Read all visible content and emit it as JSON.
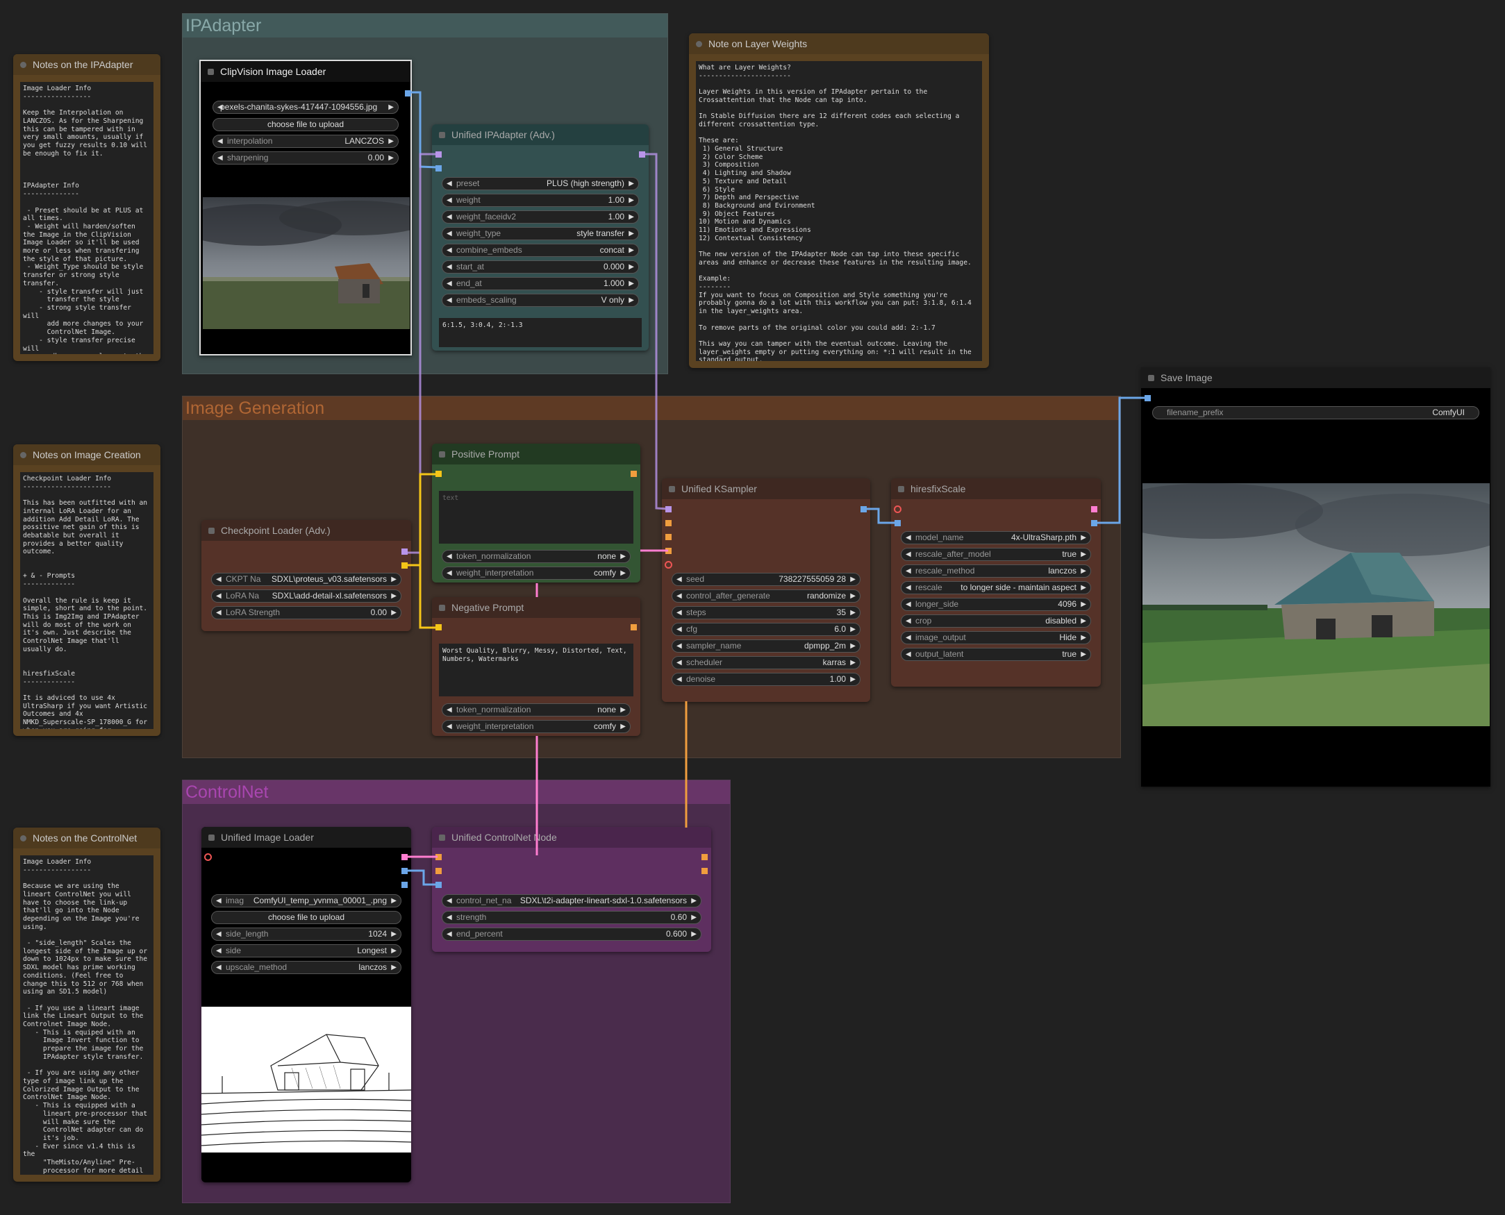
{
  "groups": {
    "ipadapter": {
      "title": "IPAdapter",
      "color": "#88a8a8"
    },
    "imagegen": {
      "title": "Image Generation",
      "color": "#b06634"
    },
    "controlnet": {
      "title": "ControlNet",
      "color": "#a946b0"
    }
  },
  "notes": {
    "ipadapter": {
      "title": "Notes on the IPAdapter",
      "text": "Image Loader Info\n-----------------\n\nKeep the Interpolation on LANCZOS. As for the Sharpening this can be tampered with in very small amounts, usually if you get fuzzy results 0.10 will be enough to fix it.\n\n\n\nIPAdapter Info\n--------------\n\n - Preset should be at PLUS at all times.\n - Weight will harden/soften the Image in the ClipVision Image Loader so it'll be used more or less when transfering the style of that picture.\n - Weight_Type should be style transfer or strong style transfer.\n    - style transfer will just\n      transfer the style\n    - strong style transfer will\n      add more changes to your\n      ControlNet Image.\n    - style transfer precise will\n      adhere even closer to the\n      original."
    },
    "layer_weights": {
      "title": "Note on Layer Weights",
      "text": "What are Layer Weights?\n-----------------------\n\nLayer Weights in this version of IPAdapter pertain to the Crossattention that the Node can tap into.\n\nIn Stable Diffusion there are 12 different codes each selecting a different crossattention type.\n\nThese are:\n 1) General Structure\n 2) Color Scheme\n 3) Composition\n 4) Lighting and Shadow\n 5) Texture and Detail\n 6) Style\n 7) Depth and Perspective\n 8) Background and Evironment\n 9) Object Features\n10) Motion and Dynamics\n11) Emotions and Expressions\n12) Contextual Consistency\n\nThe new version of the IPAdapter Node can tap into these specific areas and enhance or decrease these features in the resulting image.\n\nExample:\n--------\nIf you want to focus on Composition and Style something you're probably gonna do a lot with this workflow you can put: 3:1.8, 6:1.4 in the layer_weights area.\n\nTo remove parts of the original color you could add: 2:-1.7\n\nThis way you can tamper with the eventual outcome. Leaving the layer_weights empty or putting everything on: *:1 will result in the standard output."
    },
    "image_creation": {
      "title": "Notes on Image Creation",
      "text": "Checkpoint Loader Info\n----------------------\n\nThis has been outfitted with an internal LoRA Loader for an addition Add Detail LoRA. The possitive net gain of this is debatable but overall it provides a better quality outcome.\n\n\n+ & - Prompts\n-------------\n\nOverall the rule is keep it simple, short and to the point. This is Img2Img and IPAdapter will do most of the work on it's own. Just describe the ControlNet Image that'll usually do.\n\n\nhiresfixScale\n-------------\n\nIt is adviced to use 4x UltraSharp if you want Artistic Outcomes and 4x NMKD_Superscale-SP_178000_G for when you are going for Photographic style transfers."
    },
    "controlnet": {
      "title": "Notes on the ControlNet",
      "text": "Image Loader Info\n-----------------\n\nBecause we are using the lineart ControlNet you will have to choose the link-up that'll go into the Node depending on the Image you're using.\n\n - \"side_length\" Scales the longest side of the Image up or down to 1024px to make sure the SDXL model has prime working conditions. (Feel free to change this to 512 or 768 when using an SD1.5 model)\n\n - If you use a lineart image link the Lineart Output to the Controlnet Image Node.\n   - This is equiped with an\n     Image Invert function to\n     prepare the image for the\n     IPAdapter style transfer.\n\n - If you are using any other type of image link up the Colorized Image Output to the ControlNet Image Node.\n   - This is equipped with a\n     lineart pre-processor that\n     will make sure the\n     ControlNet adapter can do\n     it's job.\n   - Ever since v1.4 this is the\n     \"TheMisto/Anyline\" Pre-\n     processor for more detail to\n     the resulting LineArt Image."
    }
  },
  "clipvision": {
    "title": "ClipVision Image Loader",
    "image": "pexels-chanita-sykes-417447-1094556.jpg",
    "upload": "choose file to upload",
    "widgets": [
      {
        "label": "interpolation",
        "value": "LANCZOS"
      },
      {
        "label": "sharpening",
        "value": "0.00"
      }
    ]
  },
  "ipadapter_node": {
    "title": "Unified IPAdapter (Adv.)",
    "layer_weights": "6:1.5, 3:0.4, 2:-1.3",
    "widgets": [
      {
        "label": "preset",
        "value": "PLUS (high strength)"
      },
      {
        "label": "weight",
        "value": "1.00"
      },
      {
        "label": "weight_faceidv2",
        "value": "1.00"
      },
      {
        "label": "weight_type",
        "value": "style transfer"
      },
      {
        "label": "combine_embeds",
        "value": "concat"
      },
      {
        "label": "start_at",
        "value": "0.000"
      },
      {
        "label": "end_at",
        "value": "1.000"
      },
      {
        "label": "embeds_scaling",
        "value": "V only"
      }
    ]
  },
  "checkpoint": {
    "title": "Checkpoint Loader (Adv.)",
    "widgets": [
      {
        "label": "CKPT Na",
        "value": "SDXL\\proteus_v03.safetensors"
      },
      {
        "label": "LoRA Na",
        "value": "SDXL\\add-detail-xl.safetensors"
      },
      {
        "label": "LoRA Strength",
        "value": "0.00"
      }
    ]
  },
  "positive": {
    "title": "Positive Prompt",
    "placeholder": "text",
    "widgets": [
      {
        "label": "token_normalization",
        "value": "none"
      },
      {
        "label": "weight_interpretation",
        "value": "comfy"
      }
    ]
  },
  "negative": {
    "title": "Negative Prompt",
    "text": "Worst Quality, Blurry, Messy, Distorted, Text, Numbers, Watermarks",
    "widgets": [
      {
        "label": "token_normalization",
        "value": "none"
      },
      {
        "label": "weight_interpretation",
        "value": "comfy"
      }
    ]
  },
  "ksampler": {
    "title": "Unified KSampler",
    "widgets": [
      {
        "label": "seed",
        "value": "738227555059 28"
      },
      {
        "label": "control_after_generate",
        "value": "randomize"
      },
      {
        "label": "steps",
        "value": "35"
      },
      {
        "label": "cfg",
        "value": "6.0"
      },
      {
        "label": "sampler_name",
        "value": "dpmpp_2m"
      },
      {
        "label": "scheduler",
        "value": "karras"
      },
      {
        "label": "denoise",
        "value": "1.00"
      }
    ]
  },
  "hiresfix": {
    "title": "hiresfixScale",
    "widgets": [
      {
        "label": "model_name",
        "value": "4x-UltraSharp.pth"
      },
      {
        "label": "rescale_after_model",
        "value": "true"
      },
      {
        "label": "rescale_method",
        "value": "lanczos"
      },
      {
        "label": "rescale",
        "value": "to longer side - maintain aspect"
      },
      {
        "label": "longer_side",
        "value": "4096"
      },
      {
        "label": "crop",
        "value": "disabled"
      },
      {
        "label": "image_output",
        "value": "Hide"
      },
      {
        "label": "output_latent",
        "value": "true"
      }
    ]
  },
  "save": {
    "title": "Save Image",
    "widgets": [
      {
        "label": "filename_prefix",
        "value": "ComfyUI"
      }
    ]
  },
  "imgloader": {
    "title": "Unified Image Loader",
    "upload": "choose file to upload",
    "widgets": [
      {
        "label": "imag",
        "value": "ComfyUI_temp_yvnma_00001_.png"
      },
      {
        "label": "side_length",
        "value": "1024"
      },
      {
        "label": "side",
        "value": "Longest"
      },
      {
        "label": "upscale_method",
        "value": "lanczos"
      }
    ]
  },
  "cnnode": {
    "title": "Unified ControlNet Node",
    "widgets": [
      {
        "label": "control_net_na",
        "value": "SDXL\\t2i-adapter-lineart-sdxl-1.0.safetensors"
      },
      {
        "label": "strength",
        "value": "0.60"
      },
      {
        "label": "end_percent",
        "value": "0.600"
      }
    ]
  }
}
